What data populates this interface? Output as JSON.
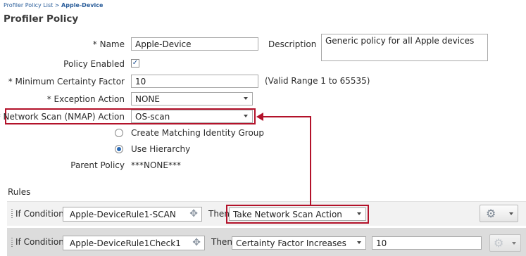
{
  "breadcrumb": {
    "parent": "Profiler Policy List",
    "separator": ">",
    "current": "Apple-Device"
  },
  "page_title": "Profiler Policy",
  "form": {
    "name_label": "* Name",
    "name_value": "Apple-Device",
    "description_label": "Description",
    "description_value": "Generic policy for all Apple devices",
    "policy_enabled_label": "Policy Enabled",
    "policy_enabled": true,
    "min_certainty_label": "* Minimum Certainty Factor",
    "min_certainty_value": "10",
    "min_certainty_hint": "(Valid Range 1 to 65535)",
    "exception_label": "* Exception Action",
    "exception_value": "NONE",
    "nmap_label": "* Network Scan (NMAP) Action",
    "nmap_value": "OS-scan",
    "radio_create": "Create Matching Identity Group",
    "radio_hierarchy": "Use Hierarchy",
    "radio_selected": "hierarchy",
    "parent_policy_label": "Parent Policy",
    "parent_policy_value": "***NONE***"
  },
  "rules": {
    "label": "Rules",
    "items": [
      {
        "if_label": "If Condition",
        "condition": "Apple-DeviceRule1-SCAN",
        "then_label": "Then",
        "action": "Take Network Scan Action"
      },
      {
        "if_label": "If Condition",
        "condition": "Apple-DeviceRule1Check1",
        "then_label": "Then",
        "action": "Certainty Factor Increases",
        "value": "10"
      }
    ]
  },
  "icons": {
    "gear": "gear-icon",
    "plus": "plus-icon",
    "check": "check-icon",
    "arrow": "red-connector-arrow"
  },
  "colors": {
    "highlight": "#b3122a",
    "link": "#2a5d9a"
  }
}
